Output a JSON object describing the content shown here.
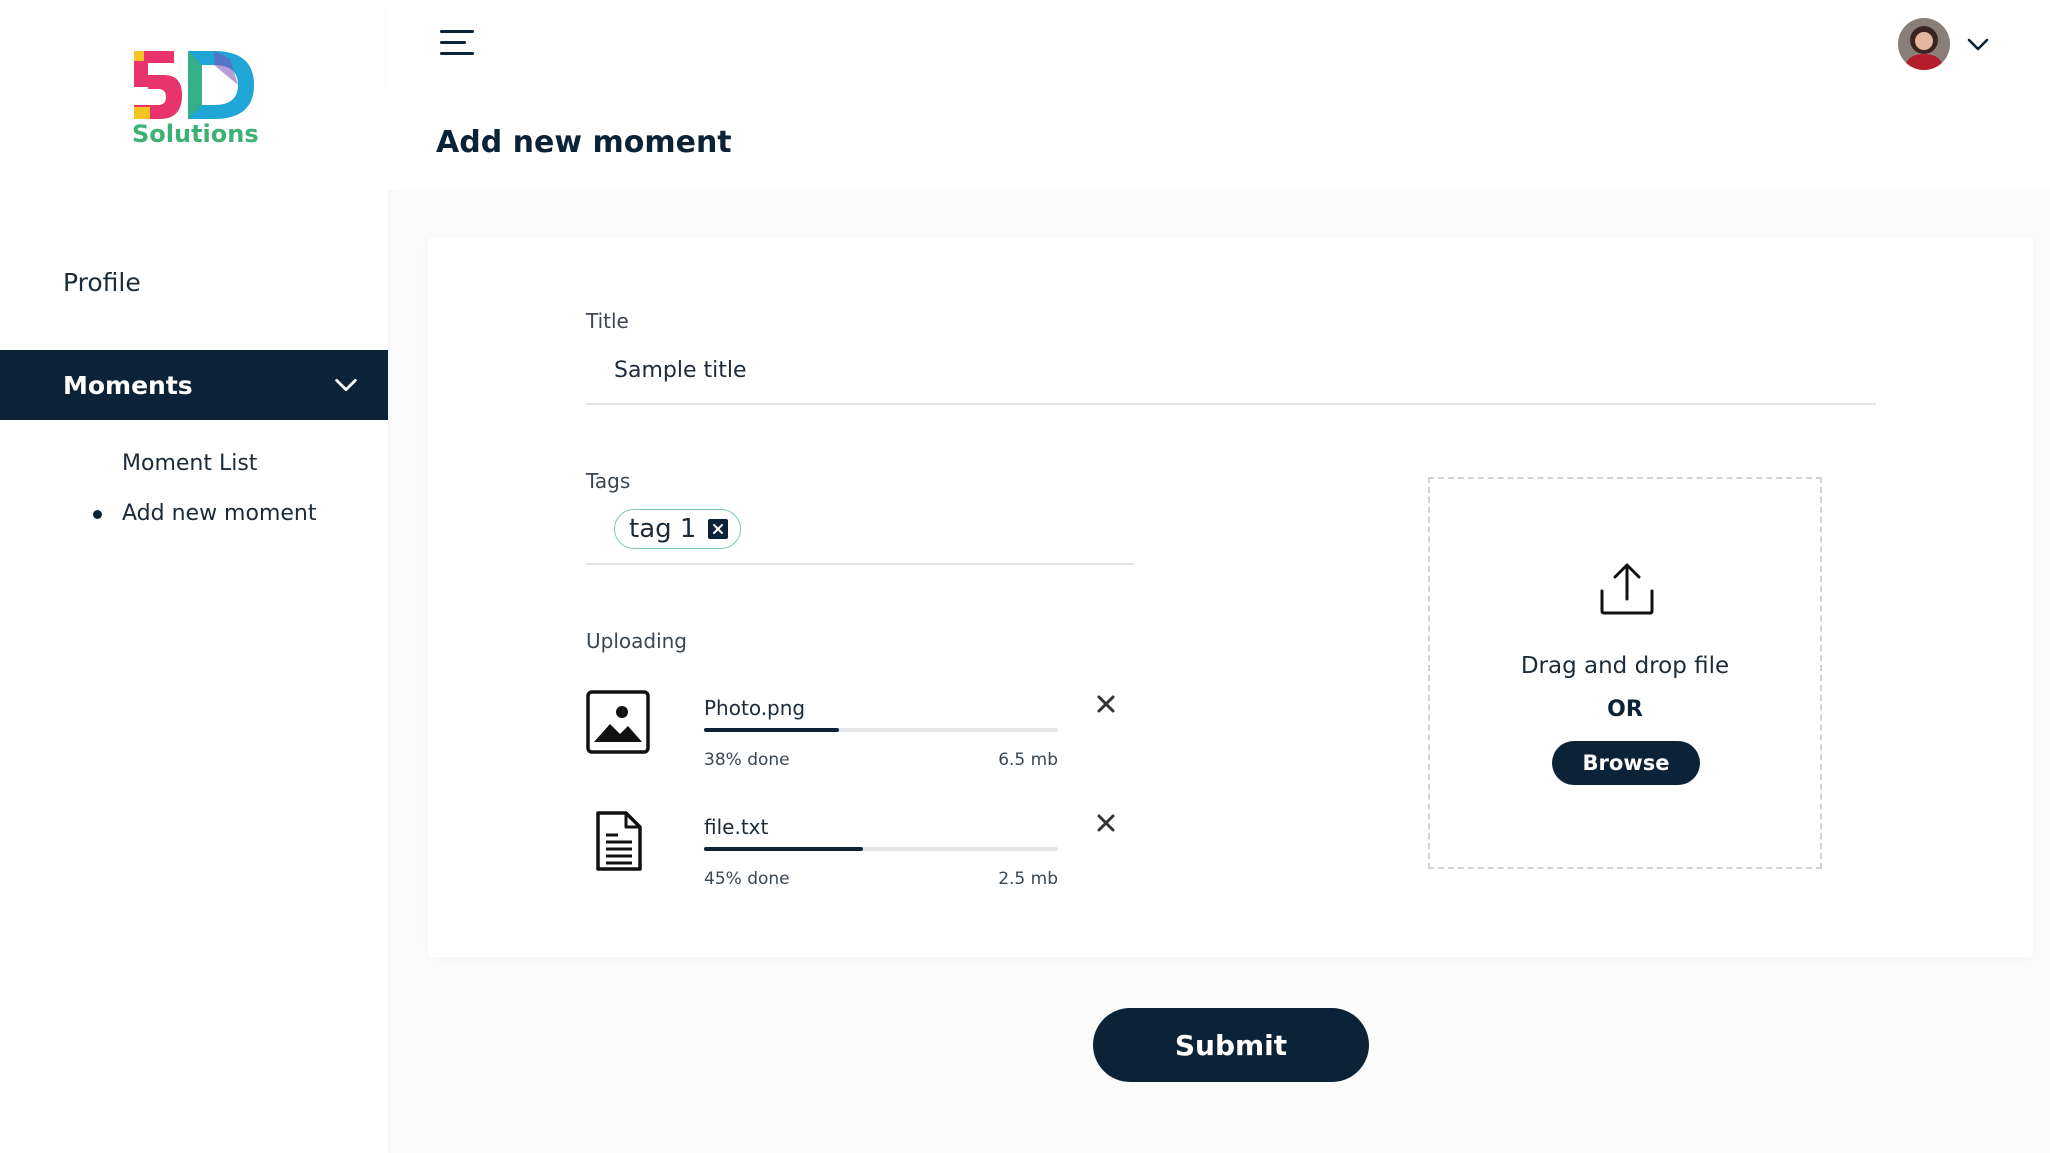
{
  "brand": {
    "logo_text": "Solutions",
    "colors": {
      "pink": "#e8336d",
      "yellow": "#f7c325",
      "cyan": "#1fa5d6",
      "green": "#3bb273"
    }
  },
  "sidebar": {
    "profile_label": "Profile",
    "moments_label": "Moments",
    "sub_items": [
      {
        "label": "Moment List",
        "active": false
      },
      {
        "label": "Add new moment",
        "active": true
      }
    ]
  },
  "header": {
    "menu_icon": "hamburger-icon",
    "avatar_icon": "user-avatar",
    "chevron_icon": "chevron-down-icon"
  },
  "page": {
    "title": "Add new moment"
  },
  "form": {
    "title_label": "Title",
    "title_value": "Sample title",
    "tags_label": "Tags",
    "tags": [
      "tag 1"
    ],
    "uploading_label": "Uploading",
    "uploads": [
      {
        "name": "Photo.png",
        "progress_text": "38% done",
        "progress": 0.38,
        "size": "6.5 mb",
        "icon": "image-file-icon"
      },
      {
        "name": "file.txt",
        "progress_text": "45% done",
        "progress": 0.45,
        "size": "2.5 mb",
        "icon": "document-file-icon"
      }
    ],
    "dropzone": {
      "text": "Drag and drop file",
      "or": "OR",
      "browse_label": "Browse"
    },
    "submit_label": "Submit"
  },
  "colors": {
    "navy": "#0c2337",
    "tag_border": "#7fc8b2"
  }
}
